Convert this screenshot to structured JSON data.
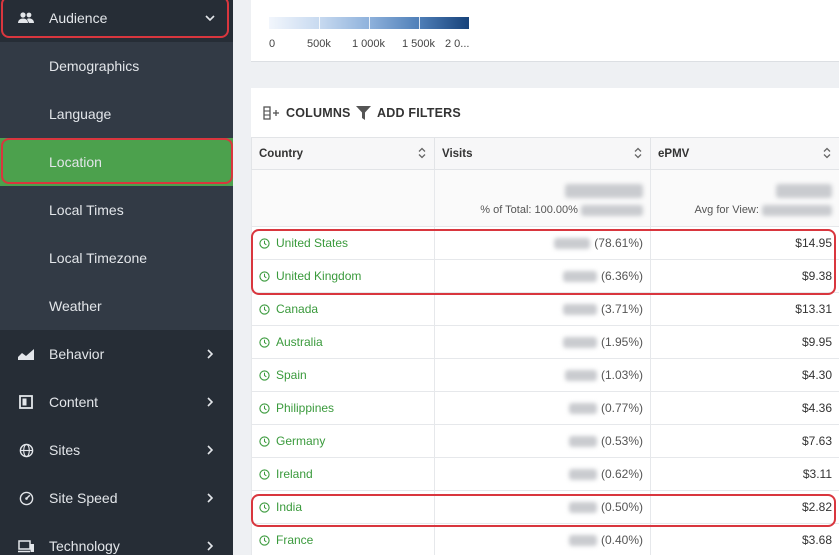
{
  "sidebar": {
    "audience": {
      "label": "Audience",
      "icon": "people-icon"
    },
    "sub_items": [
      {
        "label": "Demographics",
        "active": false
      },
      {
        "label": "Language",
        "active": false
      },
      {
        "label": "Location",
        "active": true
      },
      {
        "label": "Local Times",
        "active": false
      },
      {
        "label": "Local Timezone",
        "active": false
      },
      {
        "label": "Weather",
        "active": false
      }
    ],
    "sections": [
      {
        "label": "Behavior",
        "icon": "chart-area-icon"
      },
      {
        "label": "Content",
        "icon": "book-icon"
      },
      {
        "label": "Sites",
        "icon": "globe-icon"
      },
      {
        "label": "Site Speed",
        "icon": "speedometer-icon"
      },
      {
        "label": "Technology",
        "icon": "devices-icon"
      }
    ],
    "active_color": "#4ca14d"
  },
  "legend": {
    "labels": [
      "0",
      "500k",
      "1 000k",
      "1 500k",
      "2 0..."
    ]
  },
  "toolbar": {
    "columns_label": "COLUMNS",
    "filters_label": "ADD FILTERS"
  },
  "table": {
    "headers": [
      "Country",
      "Visits",
      "ePMV"
    ],
    "summary": {
      "visits_text": "% of Total: 100.00%",
      "epmv_text": "Avg for View:"
    },
    "rows": [
      {
        "country": "United States",
        "visits_pct": "(78.61%)",
        "epmv": "$14.95"
      },
      {
        "country": "United Kingdom",
        "visits_pct": "(6.36%)",
        "epmv": "$9.38"
      },
      {
        "country": "Canada",
        "visits_pct": "(3.71%)",
        "epmv": "$13.31"
      },
      {
        "country": "Australia",
        "visits_pct": "(1.95%)",
        "epmv": "$9.95"
      },
      {
        "country": "Spain",
        "visits_pct": "(1.03%)",
        "epmv": "$4.30"
      },
      {
        "country": "Philippines",
        "visits_pct": "(0.77%)",
        "epmv": "$4.36"
      },
      {
        "country": "Germany",
        "visits_pct": "(0.53%)",
        "epmv": "$7.63"
      },
      {
        "country": "Ireland",
        "visits_pct": "(0.62%)",
        "epmv": "$3.11"
      },
      {
        "country": "India",
        "visits_pct": "(0.50%)",
        "epmv": "$2.82"
      },
      {
        "country": "France",
        "visits_pct": "(0.40%)",
        "epmv": "$3.68"
      }
    ]
  },
  "colors": {
    "highlight_outline": "#d9363e",
    "country_link": "#3a9a3c"
  }
}
